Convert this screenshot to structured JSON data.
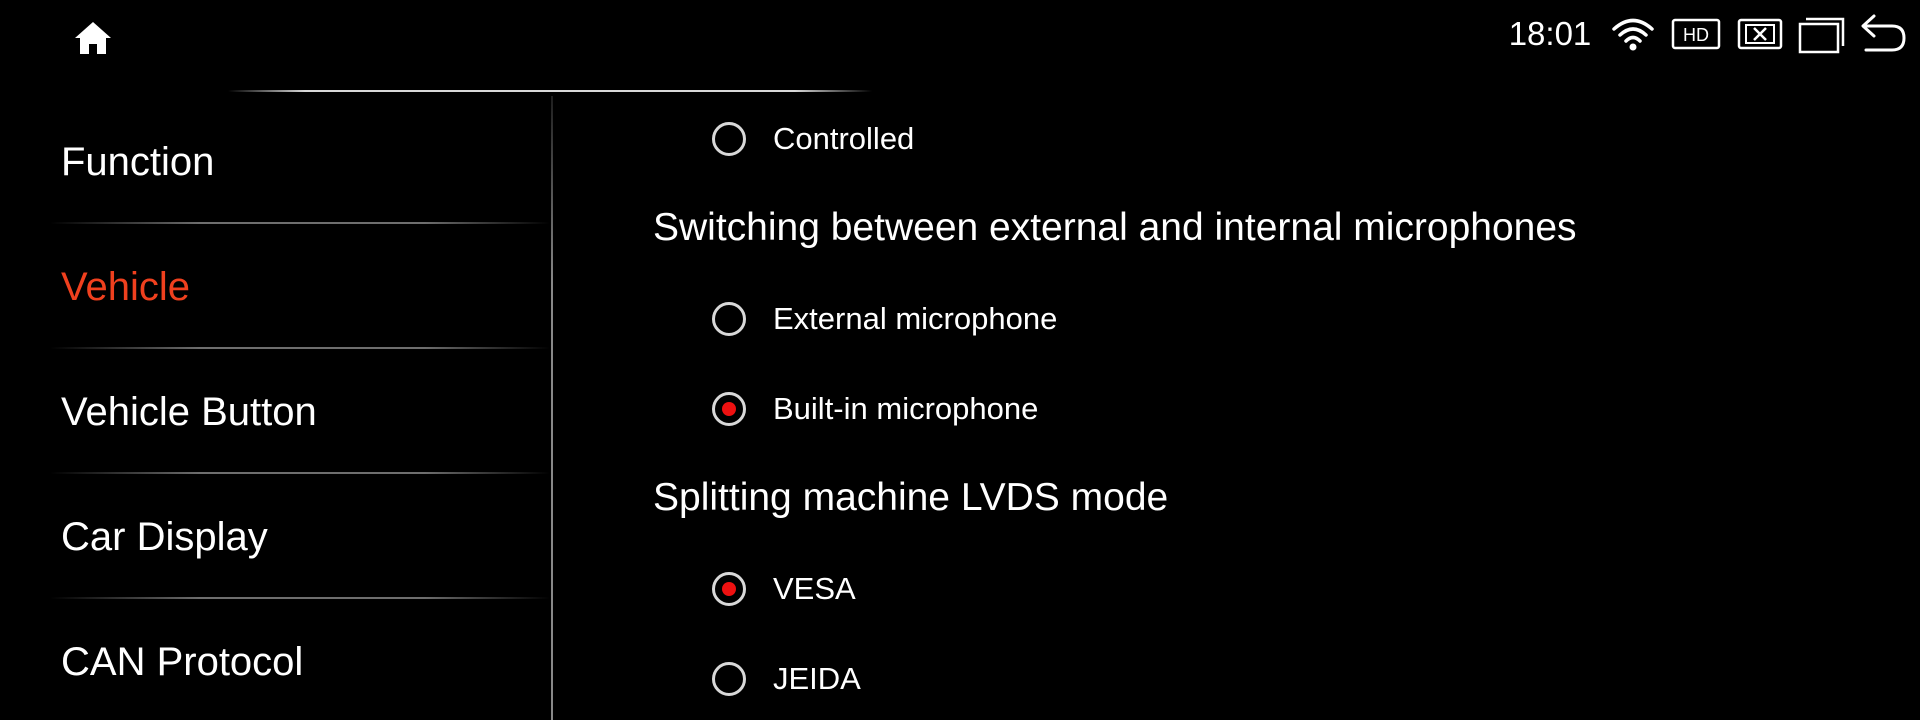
{
  "status_bar": {
    "time": "18:01",
    "icons": [
      "home-icon",
      "wifi-icon",
      "hd-icon",
      "close-box-icon",
      "windows-icon",
      "back-icon"
    ],
    "hd_text": "HD"
  },
  "colors": {
    "background": "#000000",
    "active_item": "#f0401e",
    "radio_selected": "#ee1111",
    "text": "#ffffff"
  },
  "sidebar": {
    "items": [
      {
        "label": "Function",
        "active": false
      },
      {
        "label": "Vehicle",
        "active": true
      },
      {
        "label": "Vehicle Button",
        "active": false
      },
      {
        "label": "Car Display",
        "active": false
      },
      {
        "label": "CAN Protocol",
        "active": false
      }
    ]
  },
  "content": {
    "prev_option": {
      "label": "Controlled",
      "selected": false
    },
    "mic_section": {
      "title": "Switching between external and internal microphones",
      "options": [
        {
          "label": "External microphone",
          "selected": false
        },
        {
          "label": "Built-in microphone",
          "selected": true
        }
      ]
    },
    "lvds_section": {
      "title": "Splitting machine LVDS mode",
      "options": [
        {
          "label": "VESA",
          "selected": true
        },
        {
          "label": "JEIDA",
          "selected": false
        }
      ]
    }
  }
}
